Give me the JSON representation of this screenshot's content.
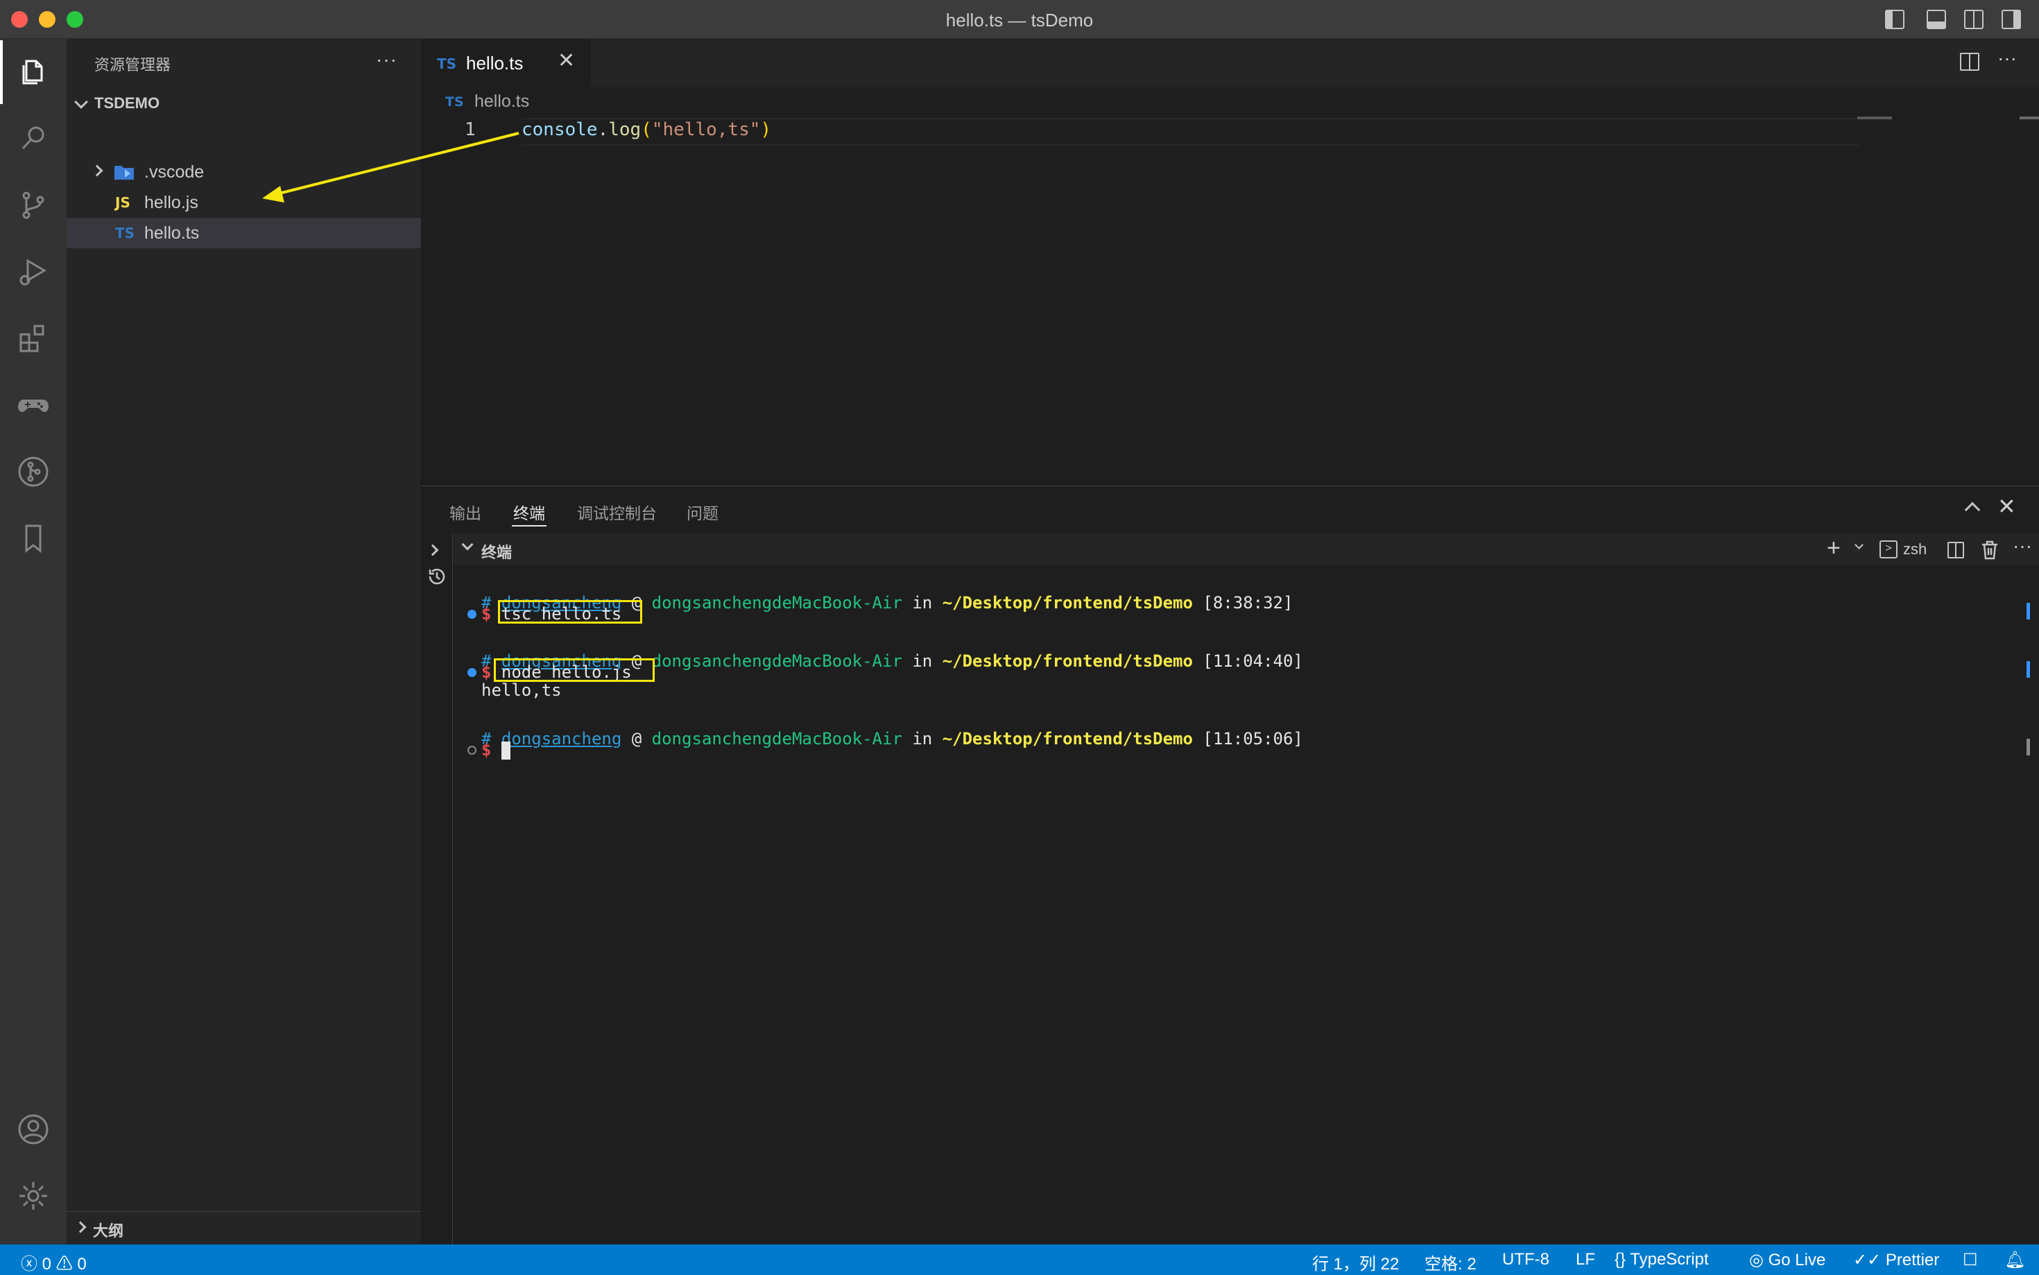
{
  "window": {
    "title": "hello.ts — tsDemo"
  },
  "sidebar": {
    "title": "资源管理器",
    "more": "···",
    "folder": "TSDEMO",
    "items": [
      {
        "icon": "",
        "label": ".vscode"
      },
      {
        "icon": "JS",
        "label": "hello.js"
      },
      {
        "icon": "TS",
        "label": "hello.ts"
      }
    ],
    "outline_label": "大纲"
  },
  "editor": {
    "tab": {
      "icon": "TS",
      "label": "hello.ts",
      "close": "✕"
    },
    "more": "···",
    "breadcrumb": {
      "icon": "TS",
      "label": "hello.ts"
    },
    "line_number": "1",
    "code": {
      "obj": "console",
      "dot": ".",
      "fn": "log",
      "open": "(",
      "str": "\"hello,ts\"",
      "close": ")"
    }
  },
  "panel": {
    "tabs": [
      "输出",
      "终端",
      "调试控制台",
      "问题"
    ],
    "close": "✕",
    "terminal_header": "终端",
    "plus": "+",
    "shell_icon": ">",
    "shell": "zsh",
    "more": "···"
  },
  "terminal": {
    "hash": "#",
    "user": "dongsancheng",
    "at": "@",
    "host": "dongsanchengdeMacBook-Air",
    "in": "in",
    "path": "~/Desktop/frontend/tsDemo",
    "dollar": "$",
    "blocks": [
      {
        "time": "[8:38:32]",
        "command": "tsc hello.ts",
        "output": ""
      },
      {
        "time": "[11:04:40]",
        "command": "node hello.js",
        "output": "hello,ts"
      },
      {
        "time": "[11:05:06]",
        "command": "",
        "output": ""
      }
    ]
  },
  "statusbar": {
    "errors": "0",
    "warnings": "0",
    "position": "行 1，列 22",
    "spaces": "空格: 2",
    "encoding": "UTF-8",
    "eol": "LF",
    "language": "TypeScript",
    "golive": "Go Live",
    "prettier": "Prettier"
  },
  "colors": {
    "activity_bar": "#333333",
    "sidebar": "#252526",
    "editor": "#1e1e1e",
    "statusbar": "#007acc",
    "annotation": "#f5e60e",
    "ts_blue": "#3178c6",
    "js_yellow": "#f1d84a"
  }
}
